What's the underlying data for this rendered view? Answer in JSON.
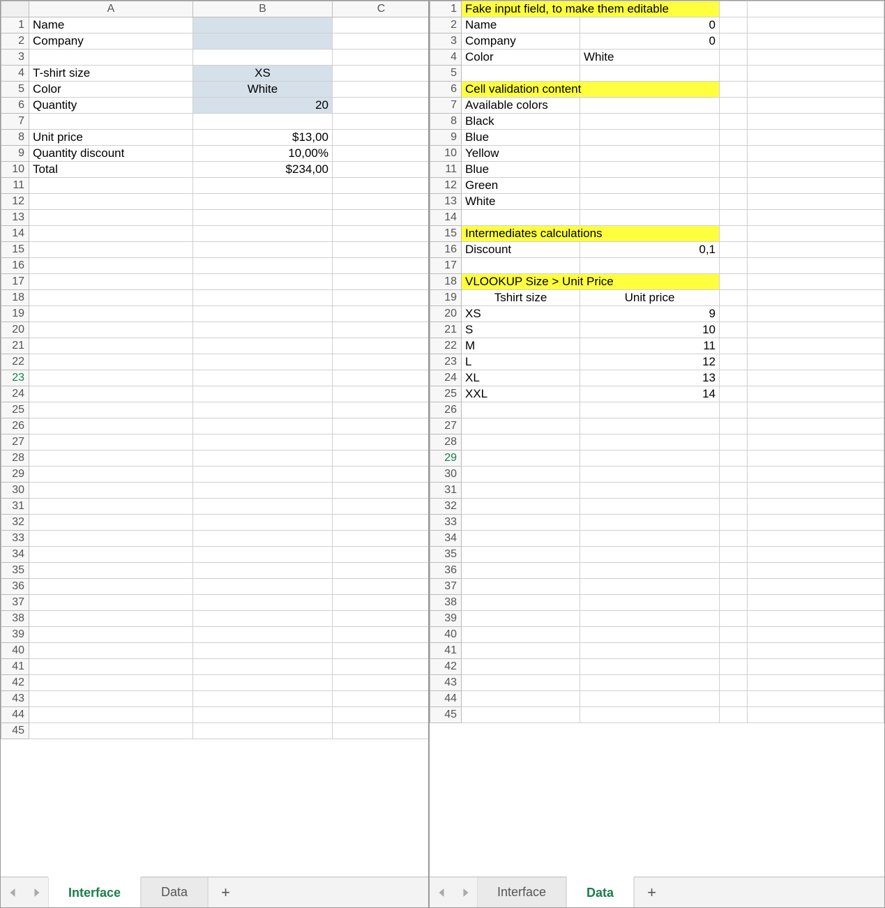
{
  "left": {
    "columns": [
      "A",
      "B",
      "C"
    ],
    "rows": {
      "visible": 45,
      "selected": 23,
      "cells": {
        "1": {
          "A": "Name"
        },
        "2": {
          "A": "Company"
        },
        "4": {
          "A": "T-shirt size",
          "B": "XS"
        },
        "5": {
          "A": "Color",
          "B": "White"
        },
        "6": {
          "A": "Quantity",
          "B": "20"
        },
        "8": {
          "A": "Unit price",
          "B": "$13,00"
        },
        "9": {
          "A": "Quantity discount",
          "B": "10,00%"
        },
        "10": {
          "A": "Total",
          "B": "$234,00"
        }
      },
      "highlight_b": [
        1,
        2,
        4,
        5,
        6
      ],
      "center_b": [
        4,
        5
      ],
      "right_b": [
        6,
        8,
        9,
        10
      ]
    },
    "tabs": {
      "active": "Interface",
      "items": [
        "Interface",
        "Data"
      ]
    }
  },
  "right": {
    "rows": {
      "visible": 45,
      "selected": 29,
      "cells": {
        "1": {
          "A": "Fake input field, to make them editable",
          "yellowAB": true
        },
        "2": {
          "A": "Name",
          "B": "0"
        },
        "3": {
          "A": "Company",
          "B": "0"
        },
        "4": {
          "A": "Color",
          "B": "White"
        },
        "6": {
          "A": "Cell validation content",
          "yellowAB": true
        },
        "7": {
          "A": "Available colors"
        },
        "8": {
          "A": "Black"
        },
        "9": {
          "A": "Blue"
        },
        "10": {
          "A": "Yellow"
        },
        "11": {
          "A": "Blue"
        },
        "12": {
          "A": "Green"
        },
        "13": {
          "A": "White"
        },
        "15": {
          "A": "Intermediates calculations",
          "yellowAB": true
        },
        "16": {
          "A": "Discount",
          "B": "0,1"
        },
        "18": {
          "A": "VLOOKUP Size > Unit Price",
          "yellowAB": true
        },
        "19": {
          "A": "Tshirt size",
          "B": "Unit price",
          "centerA": true,
          "centerB": true
        },
        "20": {
          "A": "XS",
          "B": "9"
        },
        "21": {
          "A": "S",
          "B": "10"
        },
        "22": {
          "A": "M",
          "B": "11"
        },
        "23": {
          "A": "L",
          "B": "12"
        },
        "24": {
          "A": "XL",
          "B": "13"
        },
        "25": {
          "A": "XXL",
          "B": "14"
        }
      },
      "right_b": [
        2,
        3,
        16,
        20,
        21,
        22,
        23,
        24,
        25
      ],
      "left_b_plain": [
        4
      ]
    },
    "tabs": {
      "active": "Data",
      "items": [
        "Interface",
        "Data"
      ]
    }
  }
}
